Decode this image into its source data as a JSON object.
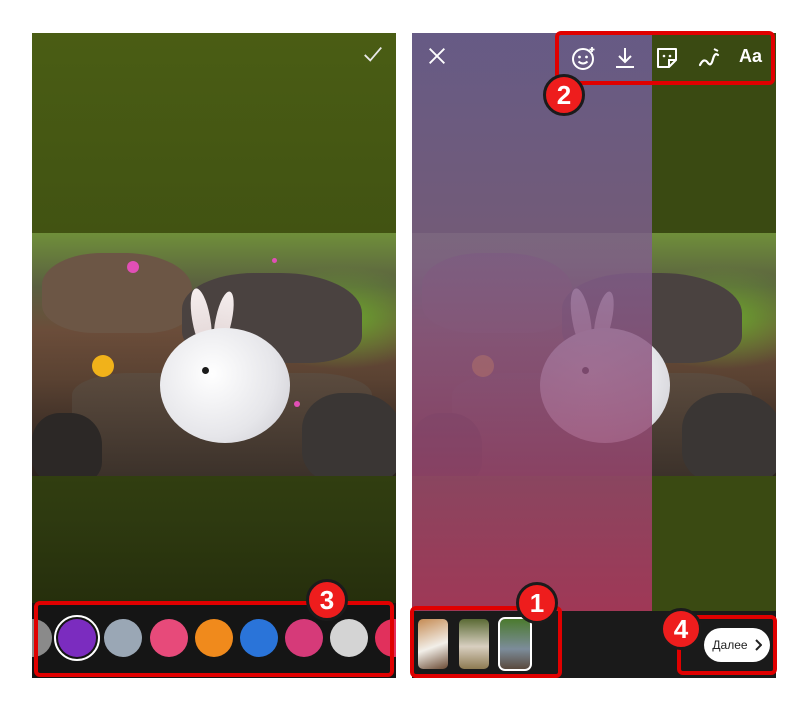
{
  "left_screen": {
    "confirm_icon": "checkmark-icon",
    "effects": [
      {
        "name": "partial-effect-icon",
        "color": "#8a8a8a"
      },
      {
        "name": "purple-sparkle-effect-icon",
        "color": "#7b2cbf",
        "selected": true
      },
      {
        "name": "eraser-effect-icon",
        "color": "#9aa7b5"
      },
      {
        "name": "pig-face-effect-icon",
        "color": "#e74a7a"
      },
      {
        "name": "heart-eyes-effect-icon",
        "color": "#f08a1c"
      },
      {
        "name": "blue-dots-effect-icon",
        "color": "#2a74d9"
      },
      {
        "name": "pink-face-effect-icon",
        "color": "#d63a79"
      },
      {
        "name": "eye-effect-icon",
        "color": "#d4d4d4"
      },
      {
        "name": "partial-pink-effect-icon",
        "color": "#e1305c"
      }
    ]
  },
  "right_screen": {
    "close_icon": "close-icon",
    "toolbar": [
      {
        "name": "face-effects-icon"
      },
      {
        "name": "download-icon"
      },
      {
        "name": "sticker-icon"
      },
      {
        "name": "draw-icon"
      }
    ],
    "text_tool_label": "Aa",
    "thumbnails": [
      {
        "name": "dog-thumbnail",
        "color": "#b77b4a"
      },
      {
        "name": "guinea-pig-thumbnail",
        "color": "#8d7a52"
      },
      {
        "name": "bunny-thumbnail",
        "color": "#7c8c9a",
        "selected": true
      }
    ],
    "next_button_label": "Далее"
  },
  "callouts": {
    "one": "1",
    "two": "2",
    "three": "3",
    "four": "4"
  },
  "colors": {
    "callout_red": "#e00000",
    "background_green": "#3f5012",
    "overlay_purple": "#7d5f8c"
  }
}
